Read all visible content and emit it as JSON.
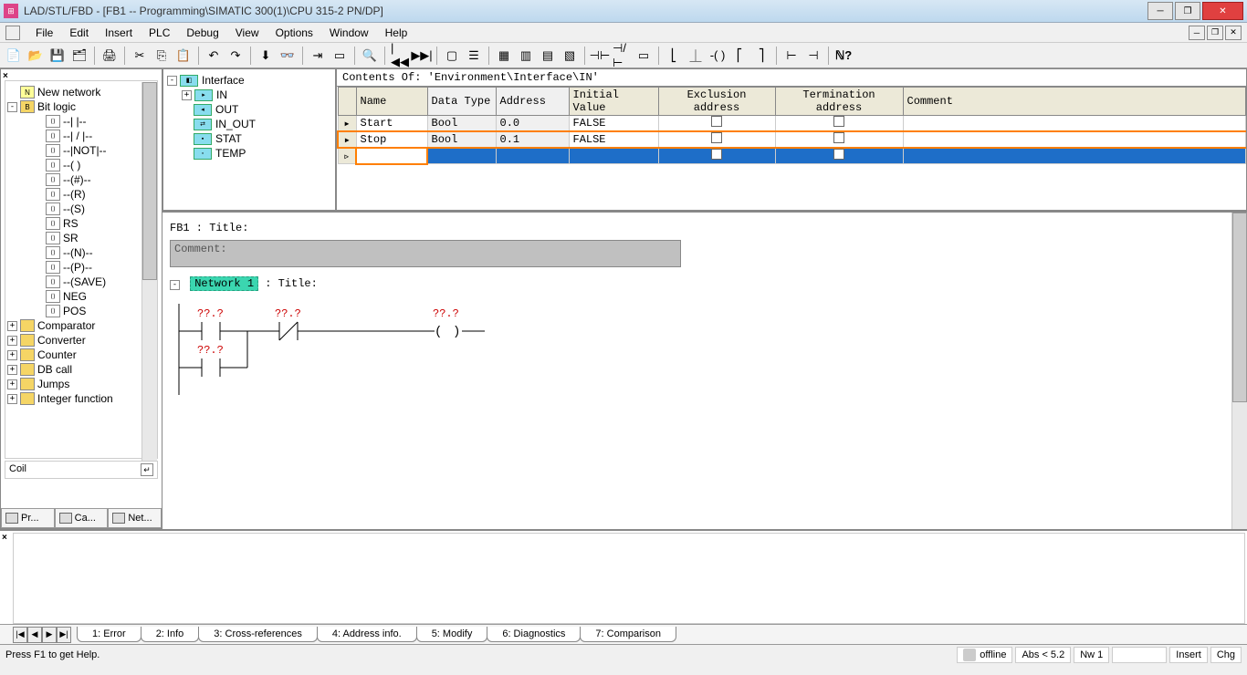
{
  "title": "LAD/STL/FBD  - [FB1 -- Programming\\SIMATIC 300(1)\\CPU 315-2 PN/DP]",
  "menu": [
    "File",
    "Edit",
    "Insert",
    "PLC",
    "Debug",
    "View",
    "Options",
    "Window",
    "Help"
  ],
  "left_tree": {
    "root": "New network",
    "bitlogic": "Bit logic",
    "items": [
      "--| |--",
      "--| / |--",
      "--|NOT|--",
      "--( )",
      "--(#)--",
      "--(R)",
      "--(S)",
      "RS",
      "SR",
      "--(N)--",
      "--(P)--",
      "--(SAVE)",
      "NEG",
      "POS"
    ],
    "folders": [
      "Comparator",
      "Converter",
      "Counter",
      "DB call",
      "Jumps",
      "Integer function"
    ]
  },
  "left_status": "Coil",
  "left_tabs": [
    "Pr...",
    "Ca...",
    "Net..."
  ],
  "iface_tree": {
    "root": "Interface",
    "items": [
      "IN",
      "OUT",
      "IN_OUT",
      "STAT",
      "TEMP"
    ]
  },
  "iface_caption": "Contents Of: 'Environment\\Interface\\IN'",
  "iface_headers": [
    "Name",
    "Data Type",
    "Address",
    "Initial Value",
    "Exclusion address",
    "Termination address",
    "Comment"
  ],
  "iface_rows": [
    {
      "name": "Start",
      "type": "Bool",
      "addr": "0.0",
      "init": "FALSE"
    },
    {
      "name": "Stop",
      "type": "Bool",
      "addr": "0.1",
      "init": "FALSE"
    }
  ],
  "ladder": {
    "fb_title": "FB1 : Title:",
    "comment_label": "Comment:",
    "network_label": "Network 1",
    "network_title": ": Title:",
    "unknown": "??.?"
  },
  "output_tabs": [
    "1: Error",
    "2: Info",
    "3: Cross-references",
    "4: Address info.",
    "5: Modify",
    "6: Diagnostics",
    "7: Comparison"
  ],
  "status": {
    "help": "Press F1 to get Help.",
    "offline": "offline",
    "abs": "Abs < 5.2",
    "nw": "Nw 1",
    "insert": "Insert",
    "chg": "Chg"
  }
}
